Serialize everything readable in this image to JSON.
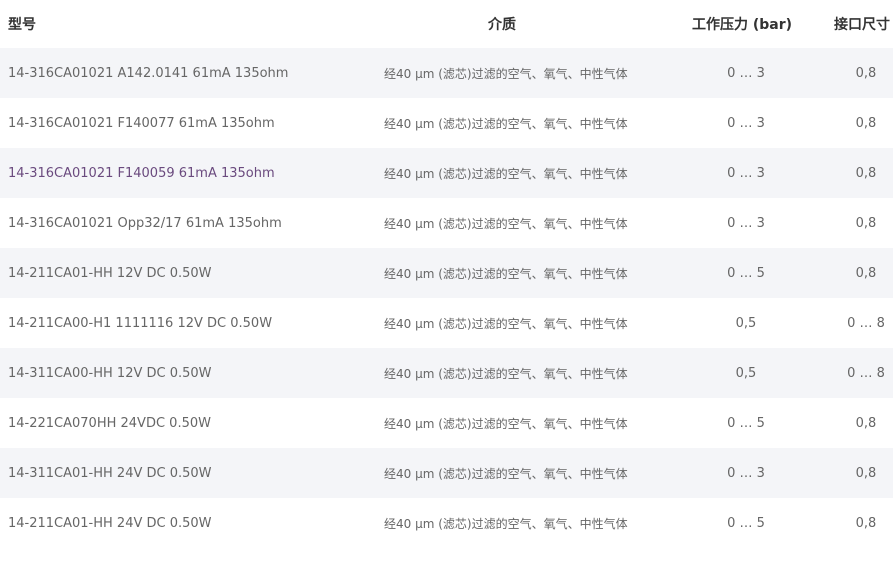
{
  "table": {
    "headers": {
      "model": "型号",
      "medium": "介质",
      "pressure": "工作压力 (bar)",
      "port": "接口尺寸"
    },
    "rows": [
      {
        "model": "14-316CA01021 A142.0141 61mA 135ohm",
        "medium": "经40 μm (滤芯)过滤的空气、氧气、中性气体",
        "pressure": "0 … 3",
        "port": "0,8"
      },
      {
        "model": "14-316CA01021 F140077 61mA 135ohm",
        "medium": "经40 μm (滤芯)过滤的空气、氧气、中性气体",
        "pressure": "0 … 3",
        "port": "0,8"
      },
      {
        "model": "14-316CA01021 F140059 61mA 135ohm",
        "medium": "经40 μm (滤芯)过滤的空气、氧气、中性气体",
        "pressure": "0 … 3",
        "port": "0,8"
      },
      {
        "model": "14-316CA01021 Opp32/17 61mA 135ohm",
        "medium": "经40 μm (滤芯)过滤的空气、氧气、中性气体",
        "pressure": "0 … 3",
        "port": "0,8"
      },
      {
        "model": "14-211CA01-HH 12V DC 0.50W",
        "medium": "经40 μm (滤芯)过滤的空气、氧气、中性气体",
        "pressure": "0 … 5",
        "port": "0,8"
      },
      {
        "model": "14-211CA00-H1 1111116 12V DC 0.50W",
        "medium": "经40 μm (滤芯)过滤的空气、氧气、中性气体",
        "pressure": "0,5",
        "port": "0 … 8"
      },
      {
        "model": "14-311CA00-HH 12V DC 0.50W",
        "medium": "经40 μm (滤芯)过滤的空气、氧气、中性气体",
        "pressure": "0,5",
        "port": "0 … 8"
      },
      {
        "model": "14-221CA070HH 24VDC 0.50W",
        "medium": "经40 μm (滤芯)过滤的空气、氧气、中性气体",
        "pressure": "0 … 5",
        "port": "0,8"
      },
      {
        "model": "14-311CA01-HH 24V DC 0.50W",
        "medium": "经40 μm (滤芯)过滤的空气、氧气、中性气体",
        "pressure": "0 … 3",
        "port": "0,8"
      },
      {
        "model": "14-211CA01-HH 24V DC 0.50W",
        "medium": "经40 μm (滤芯)过滤的空气、氧气、中性气体",
        "pressure": "0 … 5",
        "port": "0,8"
      }
    ]
  },
  "colors": {
    "row_alt_background": "#f4f5f8",
    "header_text": "#333333",
    "body_text": "#666666",
    "hover_text": "#6a4a7e"
  }
}
